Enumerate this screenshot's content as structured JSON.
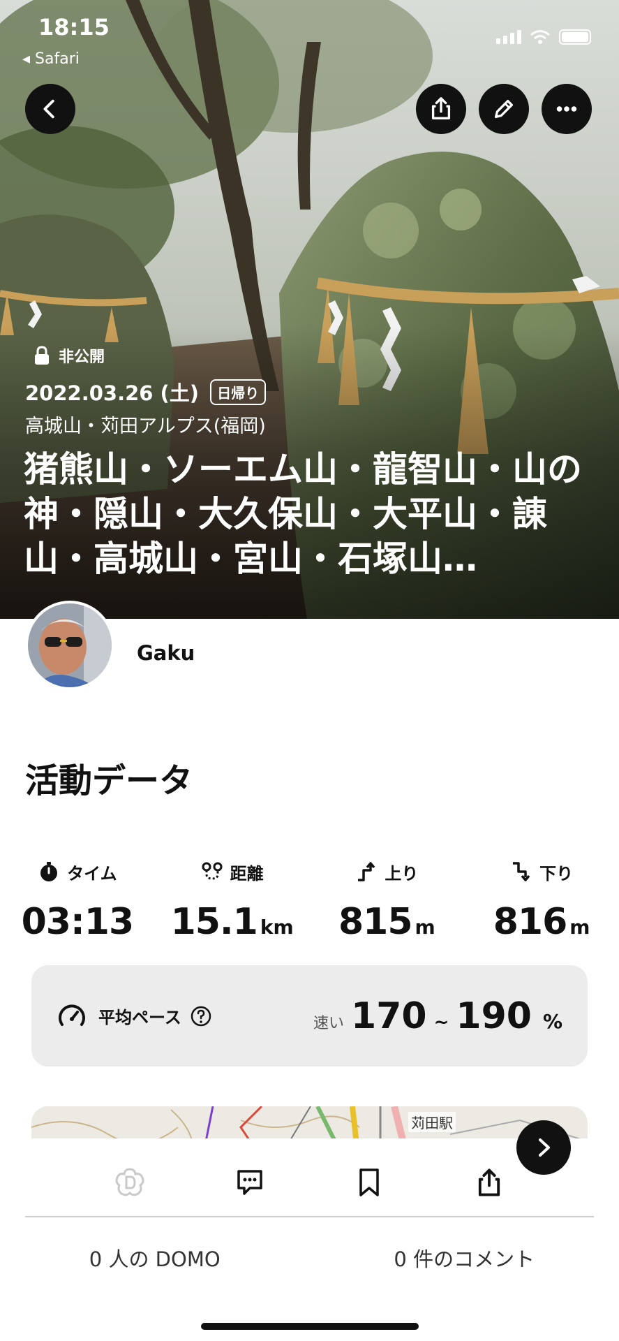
{
  "status": {
    "time": "18:15",
    "back_app": "◂ Safari"
  },
  "hero": {
    "privacy": "非公開",
    "date": "2022.03.26 (土)",
    "trip_type": "日帰り",
    "area": "高城山・苅田アルプス(福岡)",
    "title": "猪熊山・ソーエム山・龍智山・山の神・隠山・大久保山・大平山・諌山・高城山・宮山・石塚山…"
  },
  "user": {
    "name": "Gaku"
  },
  "activity": {
    "section_title": "活動データ",
    "stats": [
      {
        "icon": "stopwatch-icon",
        "label": "タイム",
        "value": "03:13",
        "unit": ""
      },
      {
        "icon": "route-icon",
        "label": "距離",
        "value": "15.1",
        "unit": "km"
      },
      {
        "icon": "ascent-icon",
        "label": "上り",
        "value": "815",
        "unit": "m"
      },
      {
        "icon": "descent-icon",
        "label": "下り",
        "value": "816",
        "unit": "m"
      }
    ],
    "pace": {
      "label": "平均ペース",
      "speed_label": "速い",
      "low": "170",
      "tilde": "~",
      "high": "190",
      "unit": "%"
    }
  },
  "map": {
    "station_label": "苅田駅"
  },
  "footer": {
    "domo_count": "0 人の DOMO",
    "comment_count": "0 件のコメント"
  }
}
